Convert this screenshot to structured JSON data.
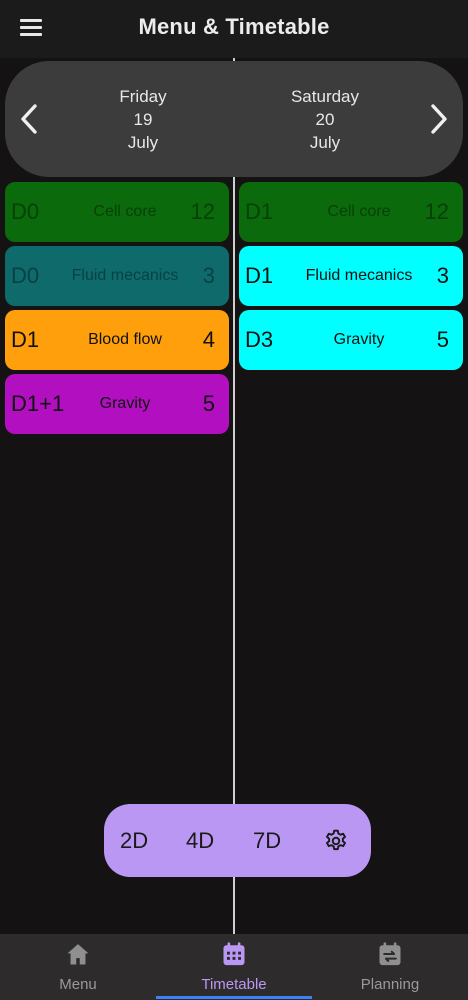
{
  "app_bar": {
    "title": "Menu & Timetable",
    "menu_icon": "hamburger-icon"
  },
  "date_header": {
    "prev_icon": "chevron-left-icon",
    "next_icon": "chevron-right-icon",
    "days": [
      {
        "weekday": "Friday",
        "day": "19",
        "month": "July"
      },
      {
        "weekday": "Saturday",
        "day": "20",
        "month": "July"
      }
    ]
  },
  "friday": [
    {
      "code": "D0",
      "name": "Cell core",
      "count": "12",
      "color": "#0b6a0b",
      "dim": true
    },
    {
      "code": "D0",
      "name": "Fluid mecanics",
      "count": "3",
      "color": "#0e6a6b",
      "dim": true
    },
    {
      "code": "D1",
      "name": "Blood flow",
      "count": "4",
      "color": "#ff9f0b",
      "dim": false
    },
    {
      "code": "D1+1",
      "name": "Gravity",
      "count": "5",
      "color": "#b10fbf",
      "dim": false
    }
  ],
  "saturday": [
    {
      "code": "D1",
      "name": "Cell core",
      "count": "12",
      "color": "#0b6a0b",
      "dim": true
    },
    {
      "code": "D1",
      "name": "Fluid mecanics",
      "count": "3",
      "color": "#00ffff",
      "dim": false
    },
    {
      "code": "D3",
      "name": "Gravity",
      "count": "5",
      "color": "#00ffff",
      "dim": false
    }
  ],
  "view_toggle": {
    "options": [
      "2D",
      "4D",
      "7D"
    ],
    "settings_icon": "gear-icon",
    "color": "#bb97f4"
  },
  "bottom_nav": {
    "items": [
      {
        "label": "Menu",
        "icon": "home-icon"
      },
      {
        "label": "Timetable",
        "icon": "calendar-grid-icon"
      },
      {
        "label": "Planning",
        "icon": "calendar-swap-icon"
      }
    ],
    "active": "Timetable",
    "active_color": "#bb97f4",
    "indicator_color": "#3b82f6"
  }
}
